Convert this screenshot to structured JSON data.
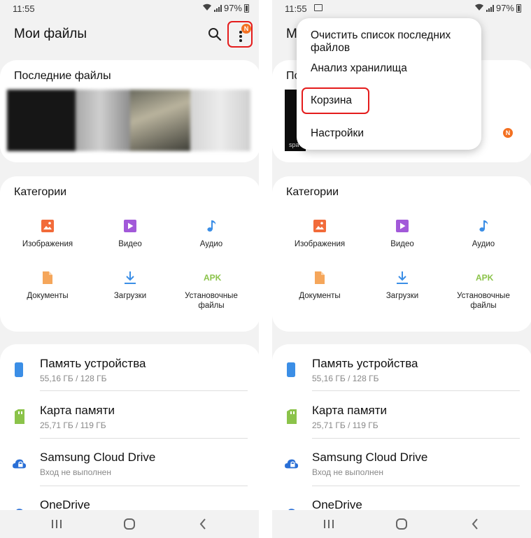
{
  "status_bar": {
    "time": "11:55",
    "battery": "97%"
  },
  "app": {
    "title": "Мои файлы"
  },
  "recent": {
    "title": "Последние файлы",
    "caption_visible": "spa"
  },
  "categories": {
    "title": "Категории",
    "items": [
      {
        "label": "Изображения",
        "icon": "image-icon",
        "color": "#f26b3a"
      },
      {
        "label": "Видео",
        "icon": "video-icon",
        "color": "#a259d9"
      },
      {
        "label": "Аудио",
        "icon": "music-note-icon",
        "color": "#3b8ee6"
      },
      {
        "label": "Документы",
        "icon": "document-icon",
        "color": "#f5a65b"
      },
      {
        "label": "Загрузки",
        "icon": "download-icon",
        "color": "#3b8ee6"
      },
      {
        "label": "Установочные файлы",
        "icon_text": "APK",
        "color": "#8bc34a"
      }
    ]
  },
  "storage": {
    "items": [
      {
        "name": "Память устройства",
        "detail": "55,16 ГБ / 128 ГБ",
        "icon": "phone-storage-icon",
        "color": "#3b8ee6"
      },
      {
        "name": "Карта памяти",
        "detail": "25,71 ГБ / 119 ГБ",
        "icon": "sd-card-icon",
        "color": "#8bc34a"
      },
      {
        "name": "Samsung Cloud Drive",
        "detail": "Вход не выполнен",
        "icon": "cloud-icon",
        "color": "#2a6fd6"
      },
      {
        "name": "OneDrive",
        "detail": "",
        "icon": "onedrive-icon",
        "color": "#2a6fd6"
      }
    ]
  },
  "menu": {
    "items": [
      {
        "label": "Очистить список последних файлов"
      },
      {
        "label": "Анализ хранилища"
      },
      {
        "label": "Корзина"
      },
      {
        "label": "Настройки"
      }
    ]
  },
  "badge_letter": "N",
  "colors": {
    "accent_badge": "#f37021",
    "highlight": "#e41c1c",
    "background": "#f2f2f2"
  }
}
